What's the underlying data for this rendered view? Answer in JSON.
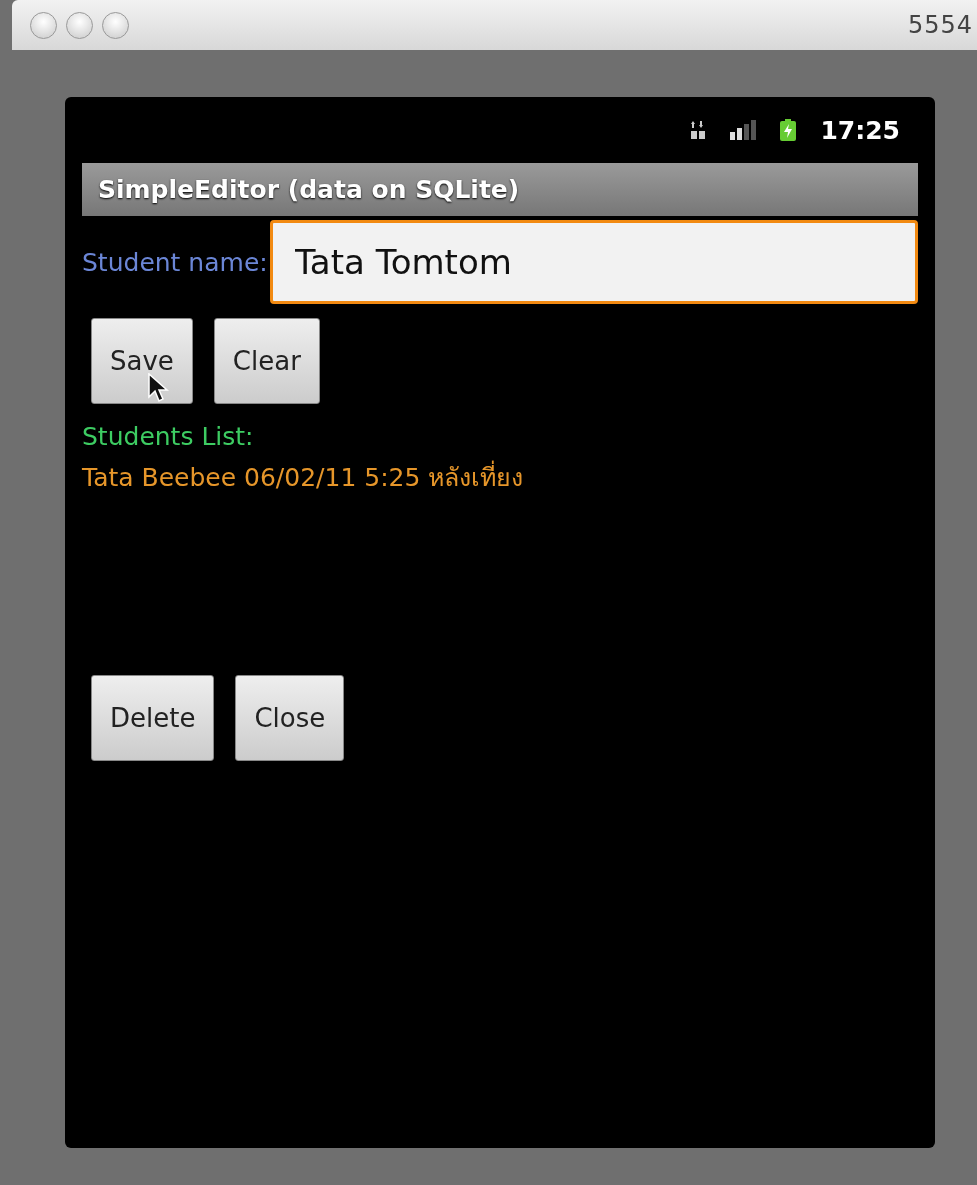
{
  "window": {
    "title": "5554"
  },
  "status_bar": {
    "time": "17:25"
  },
  "app_title": "SimpleEditor (data on SQLite)",
  "name_field": {
    "label": "Student name:",
    "value": "Tata Tomtom",
    "focused": true
  },
  "top_buttons": [
    "Save",
    "Clear"
  ],
  "list": {
    "heading": "Students List:",
    "items": [
      "Tata Beebee 06/02/11 5:25 หลังเที่ยง"
    ]
  },
  "bottom_buttons": [
    "Delete",
    "Close"
  ]
}
